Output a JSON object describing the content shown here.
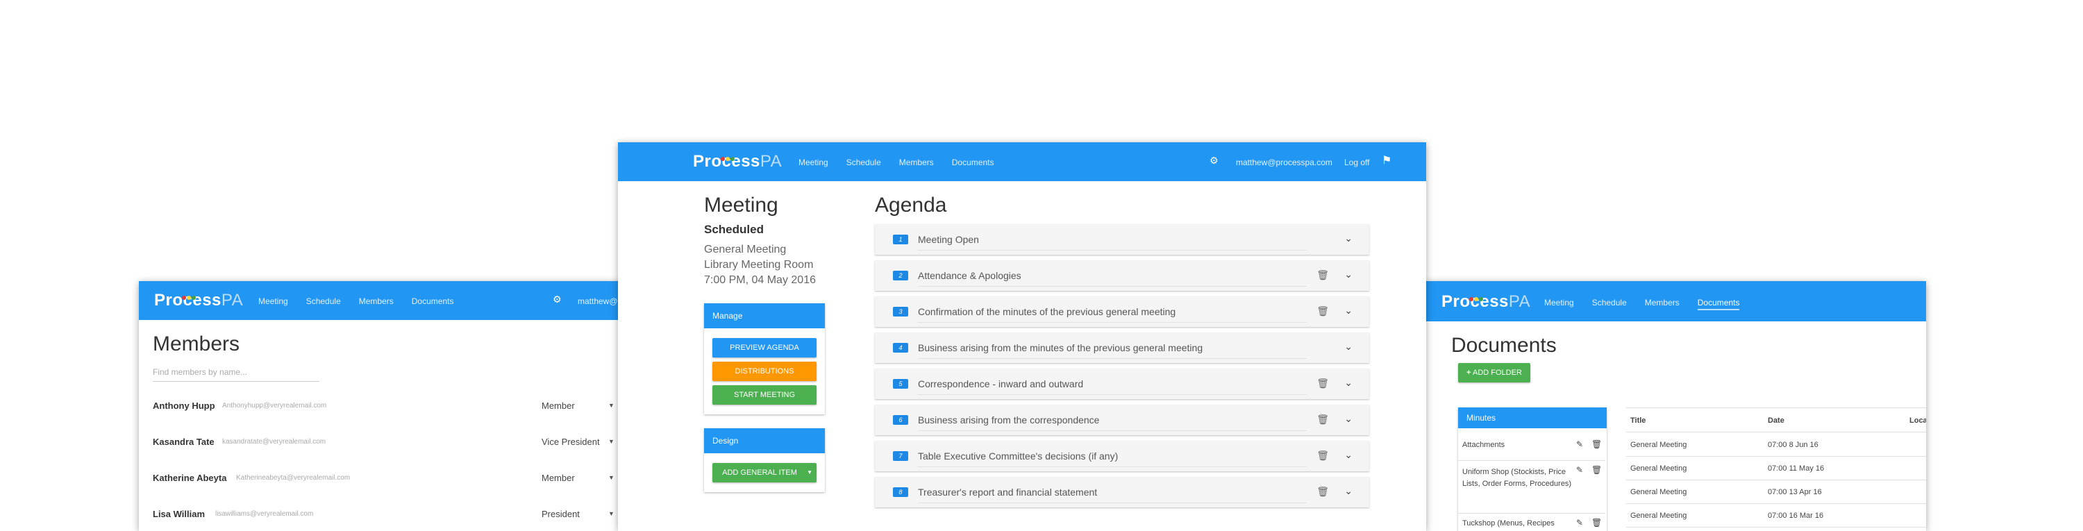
{
  "brand": {
    "name_bold": "Process",
    "name_light": "PA",
    "dot_colors": [
      "#e53935",
      "#fdd835",
      "#43a047"
    ]
  },
  "center": {
    "nav": {
      "links": [
        "Meeting",
        "Schedule",
        "Members",
        "Documents"
      ],
      "email": "matthew@processpa.com",
      "logoff": "Log off"
    },
    "meeting": {
      "heading": "Meeting",
      "status": "Scheduled",
      "type": "General Meeting",
      "location": "Library Meeting Room",
      "datetime": "7:00 PM, 04 May 2016"
    },
    "manage": {
      "title": "Manage",
      "preview": "PREVIEW AGENDA",
      "distributions": "DISTRIBUTIONS",
      "start": "START MEETING"
    },
    "design": {
      "title": "Design",
      "add": "ADD GENERAL ITEM"
    },
    "agenda": {
      "heading": "Agenda",
      "items": [
        {
          "num": "1",
          "text": "Meeting Open",
          "trash": false
        },
        {
          "num": "2",
          "text": "Attendance & Apologies",
          "trash": true
        },
        {
          "num": "3",
          "text": "Confirmation of the minutes of the previous general meeting",
          "trash": true
        },
        {
          "num": "4",
          "text": "Business arising from the minutes of the previous general meeting",
          "trash": false
        },
        {
          "num": "5",
          "text": "Correspondence - inward and outward",
          "trash": true
        },
        {
          "num": "6",
          "text": "Business arising from the correspondence",
          "trash": true
        },
        {
          "num": "7",
          "text": "Table Executive Committee's decisions (if any)",
          "trash": true
        },
        {
          "num": "8",
          "text": "Treasurer's report and financial statement",
          "trash": true
        }
      ]
    }
  },
  "left": {
    "nav": {
      "links": [
        "Meeting",
        "Schedule",
        "Members",
        "Documents"
      ],
      "email": "matthew@"
    },
    "heading": "Members",
    "search_placeholder": "Find members by name...",
    "members": [
      {
        "name": "Anthony Hupp",
        "email": "Anthonyhupp@veryrealemail.com",
        "role": "Member"
      },
      {
        "name": "Kasandra Tate",
        "email": "kasandratate@veryrealemail.com",
        "role": "Vice President"
      },
      {
        "name": "Katherine Abeyta",
        "email": "Katherineabeyta@veryrealemail.com",
        "role": "Member"
      },
      {
        "name": "Lisa William",
        "email": "lisawilliams@veryrealemail.com",
        "role": "President"
      }
    ]
  },
  "right": {
    "nav": {
      "links": [
        "Meeting",
        "Schedule",
        "Members",
        "Documents"
      ],
      "active": "Documents"
    },
    "heading": "Documents",
    "add_folder": "ADD FOLDER",
    "folders_title": "Minutes",
    "folders": [
      "Attachments",
      "Uniform Shop (Stockists, Price Lists, Order Forms, Procedures)",
      "Tuckshop (Menus, Recipes"
    ],
    "table": {
      "headers": [
        "Title",
        "Date",
        "Location"
      ],
      "rows": [
        {
          "title": "General Meeting",
          "date": "07:00 8 Jun 16"
        },
        {
          "title": "General Meeting",
          "date": "07:00 11 May 16"
        },
        {
          "title": "General Meeting",
          "date": "07:00 13 Apr 16"
        },
        {
          "title": "General Meeting",
          "date": "07:00 16 Mar 16"
        }
      ]
    }
  }
}
